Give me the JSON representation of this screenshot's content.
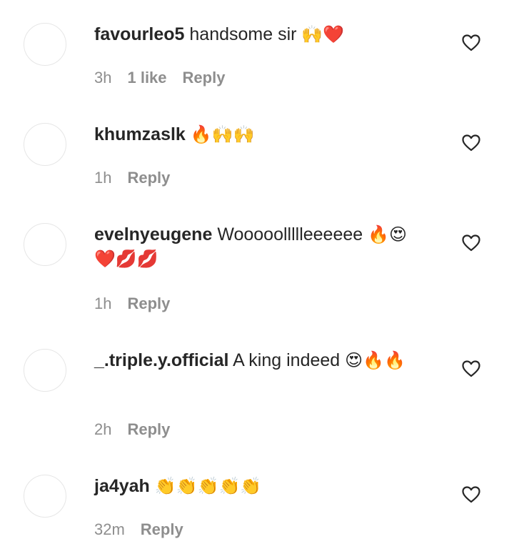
{
  "comments": [
    {
      "username": "favourleo5",
      "text": "handsome sir",
      "emoji": "🙌❤️",
      "time": "3h",
      "likes": "1 like",
      "reply": "Reply"
    },
    {
      "username": "khumzaslk",
      "text": "",
      "emoji": "🔥🙌🙌",
      "time": "1h",
      "likes": "",
      "reply": "Reply"
    },
    {
      "username": "evelnyeugene",
      "text": "Wooooollllleeeeee",
      "emoji": "🔥😍❤️💋💋",
      "time": "1h",
      "likes": "",
      "reply": "Reply"
    },
    {
      "username": "_.triple.y.official",
      "text": "A king indeed",
      "emoji": "😍🔥🔥",
      "time": "2h",
      "likes": "",
      "reply": "Reply"
    },
    {
      "username": "ja4yah",
      "text": "",
      "emoji": "👏👏👏👏👏",
      "time": "32m",
      "likes": "",
      "reply": "Reply"
    }
  ]
}
